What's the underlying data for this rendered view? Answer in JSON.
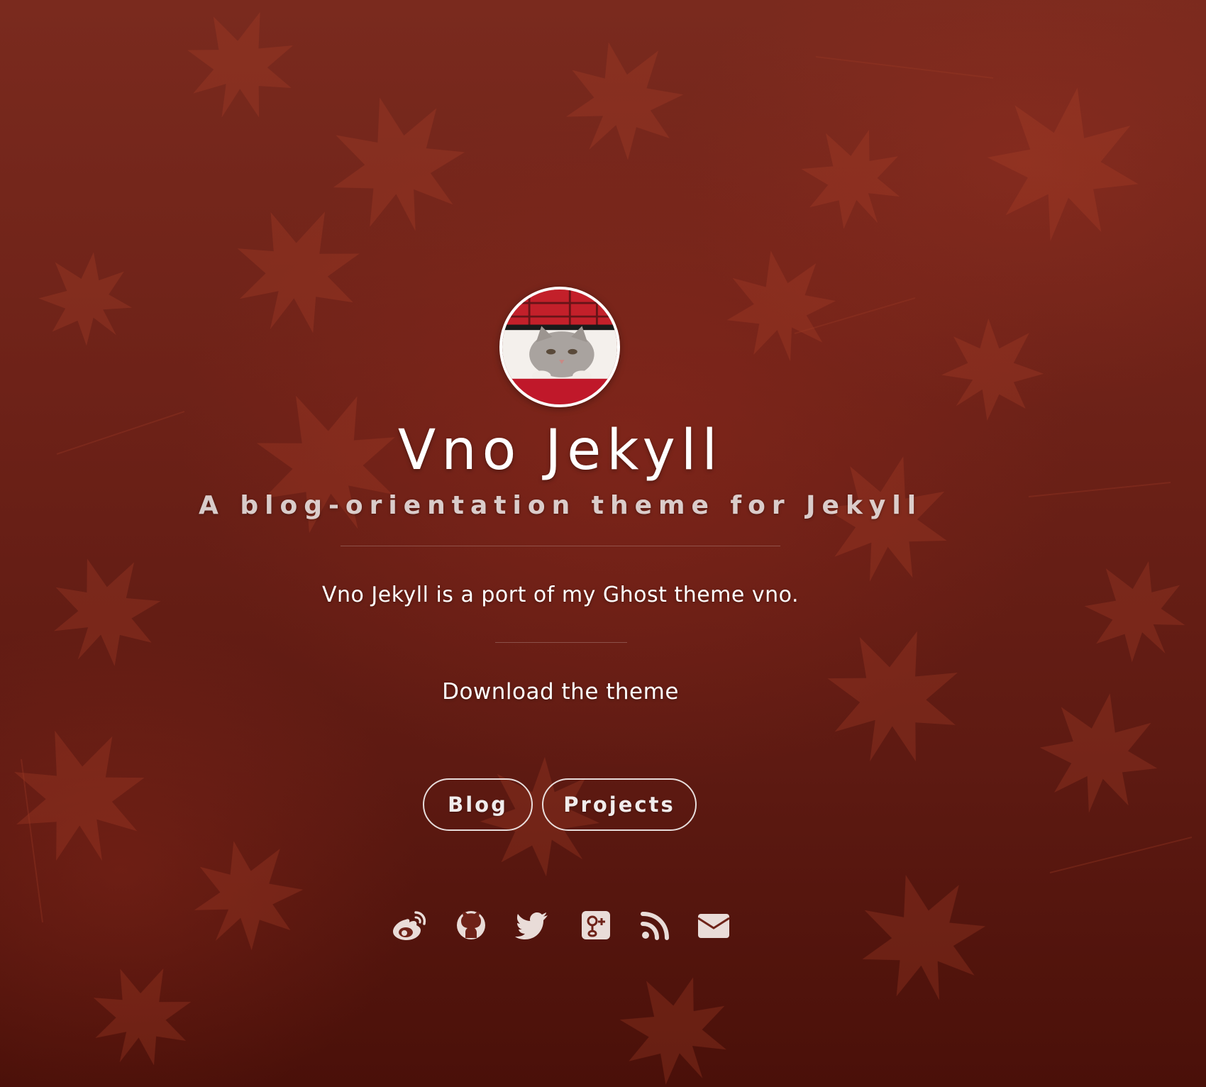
{
  "site": {
    "title": "Vno Jekyll",
    "subtitle": "A blog-orientation theme for Jekyll",
    "description": "Vno Jekyll is a port of my Ghost theme vno.",
    "download_label": "Download the theme"
  },
  "nav": {
    "buttons": [
      {
        "label": "Blog"
      },
      {
        "label": "Projects"
      }
    ]
  },
  "social": {
    "icons": [
      "weibo-icon",
      "github-icon",
      "twitter-icon",
      "google-plus-icon",
      "rss-icon",
      "email-icon"
    ]
  },
  "colors": {
    "background": "#6e2218",
    "text": "#ffffff",
    "icon": "#e9dcd8"
  }
}
